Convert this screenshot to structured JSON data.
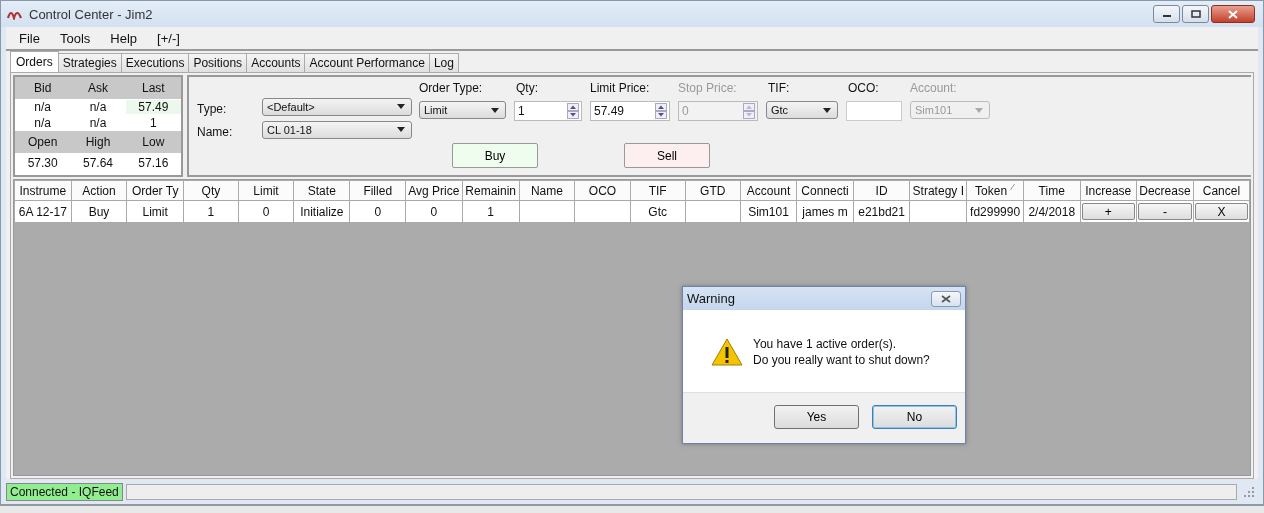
{
  "window": {
    "title": "Control Center - Jim2"
  },
  "menu": [
    "File",
    "Tools",
    "Help",
    "[+/-]"
  ],
  "tabs": [
    {
      "label": "Orders",
      "selected": true
    },
    {
      "label": "Strategies",
      "selected": false
    },
    {
      "label": "Executions",
      "selected": false
    },
    {
      "label": "Positions",
      "selected": false
    },
    {
      "label": "Accounts",
      "selected": false
    },
    {
      "label": "Account Performance",
      "selected": false
    },
    {
      "label": "Log",
      "selected": false
    }
  ],
  "quote": {
    "headers_1": [
      "Bid",
      "Ask",
      "Last"
    ],
    "rows_1": [
      [
        "n/a",
        "n/a",
        "57.49"
      ],
      [
        "n/a",
        "n/a",
        "1"
      ]
    ],
    "headers_2": [
      "Open",
      "High",
      "Low"
    ],
    "rows_2": [
      [
        "57.30",
        "57.64",
        "57.16"
      ]
    ]
  },
  "order_entry": {
    "type": {
      "label": "Type:",
      "value": "<Default>"
    },
    "name": {
      "label": "Name:",
      "value": "CL 01-18"
    },
    "fields": [
      {
        "label": "Order Type:",
        "kind": "combo",
        "value": "Limit",
        "disabled": false
      },
      {
        "label": "Qty:",
        "kind": "spin",
        "value": "1",
        "disabled": false
      },
      {
        "label": "Limit Price:",
        "kind": "spin",
        "value": "57.49",
        "disabled": false
      },
      {
        "label": "Stop Price:",
        "kind": "spin",
        "value": "0",
        "disabled": true
      },
      {
        "label": "TIF:",
        "kind": "combo",
        "value": "Gtc",
        "disabled": false
      },
      {
        "label": "OCO:",
        "kind": "text",
        "disabled": false
      },
      {
        "label": "Account:",
        "kind": "combo",
        "value": "Sim101",
        "disabled": true
      }
    ],
    "buttons": [
      {
        "label": "Buy",
        "kind": "buy"
      },
      {
        "label": "Sell",
        "kind": "sell"
      }
    ]
  },
  "orders_table": {
    "columns": [
      {
        "label": "Instrume",
        "sorted": false
      },
      {
        "label": "Action",
        "sorted": false
      },
      {
        "label": "Order Ty",
        "sorted": false
      },
      {
        "label": "Qty",
        "sorted": false
      },
      {
        "label": "Limit",
        "sorted": false
      },
      {
        "label": "State",
        "sorted": false
      },
      {
        "label": "Filled",
        "sorted": false
      },
      {
        "label": "Avg Price",
        "sorted": false
      },
      {
        "label": "Remainin",
        "sorted": false
      },
      {
        "label": "Name",
        "sorted": false
      },
      {
        "label": "OCO",
        "sorted": false
      },
      {
        "label": "TIF",
        "sorted": false
      },
      {
        "label": "GTD",
        "sorted": false
      },
      {
        "label": "Account",
        "sorted": false
      },
      {
        "label": "Connecti",
        "sorted": false
      },
      {
        "label": "ID",
        "sorted": false
      },
      {
        "label": "Strategy I",
        "sorted": false
      },
      {
        "label": "Token",
        "sorted": true
      },
      {
        "label": "Time",
        "sorted": false
      },
      {
        "label": "Increase",
        "sorted": false
      },
      {
        "label": "Decrease",
        "sorted": false
      },
      {
        "label": "Cancel",
        "sorted": false
      }
    ],
    "rows": [
      {
        "cells": [
          "6A 12-17",
          "Buy",
          "Limit",
          "1",
          "0",
          "Initialize",
          "0",
          "0",
          "1",
          "",
          "",
          "Gtc",
          "",
          "Sim101",
          "james m",
          "e21bd21",
          "",
          "fd299990",
          "2/4/2018"
        ],
        "buttons": [
          "+",
          "-",
          "X"
        ]
      }
    ]
  },
  "dialog": {
    "title": "Warning",
    "message": [
      "You have 1 active order(s).",
      "Do you really want to shut down?"
    ],
    "buttons": [
      {
        "label": "Yes",
        "selected": false
      },
      {
        "label": "No",
        "selected": true
      }
    ]
  },
  "status_bar": {
    "connection": "Connected - IQFeed"
  }
}
